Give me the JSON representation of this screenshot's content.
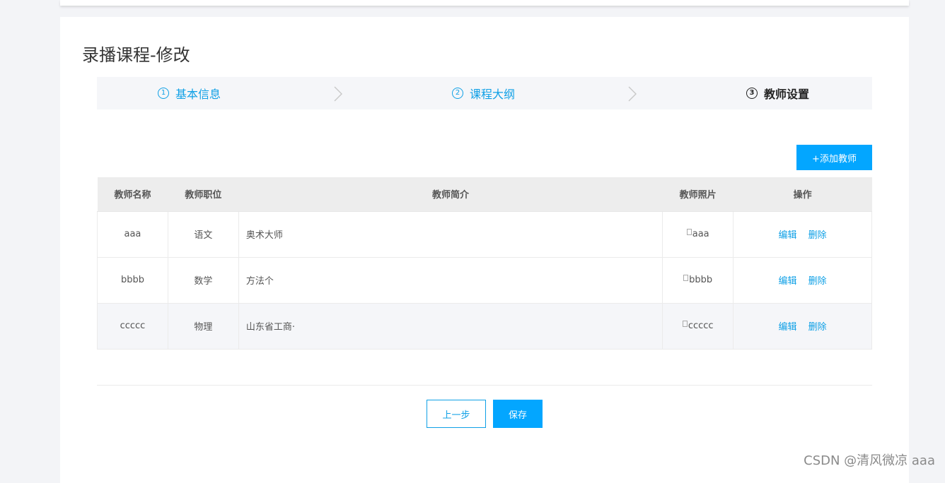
{
  "page": {
    "title": "录播课程-修改"
  },
  "steps": [
    {
      "num": "1",
      "label": "基本信息"
    },
    {
      "num": "2",
      "label": "课程大纲"
    },
    {
      "num": "3",
      "label": "教师设置"
    }
  ],
  "toolbar": {
    "add_teacher_label": "+添加教师"
  },
  "table": {
    "headers": [
      "教师名称",
      "教师职位",
      "教师简介",
      "教师照片",
      "操作"
    ],
    "rows": [
      {
        "name": "aaa",
        "position": "语文",
        "intro": "奥术大师",
        "photo_alt": "aaa",
        "edit": "编辑",
        "delete": "删除"
      },
      {
        "name": "bbbb",
        "position": "数学",
        "intro": "方法个",
        "photo_alt": "bbbb",
        "edit": "编辑",
        "delete": "删除"
      },
      {
        "name": "ccccc",
        "position": "物理",
        "intro": "山东省工商·",
        "photo_alt": "ccccc",
        "edit": "编辑",
        "delete": "删除"
      }
    ]
  },
  "footer": {
    "prev_label": "上一步",
    "save_label": "保存"
  },
  "watermark": "CSDN @清风微凉 aaa",
  "colors": {
    "accent": "#03a6ff",
    "link": "#0fa0e6"
  }
}
